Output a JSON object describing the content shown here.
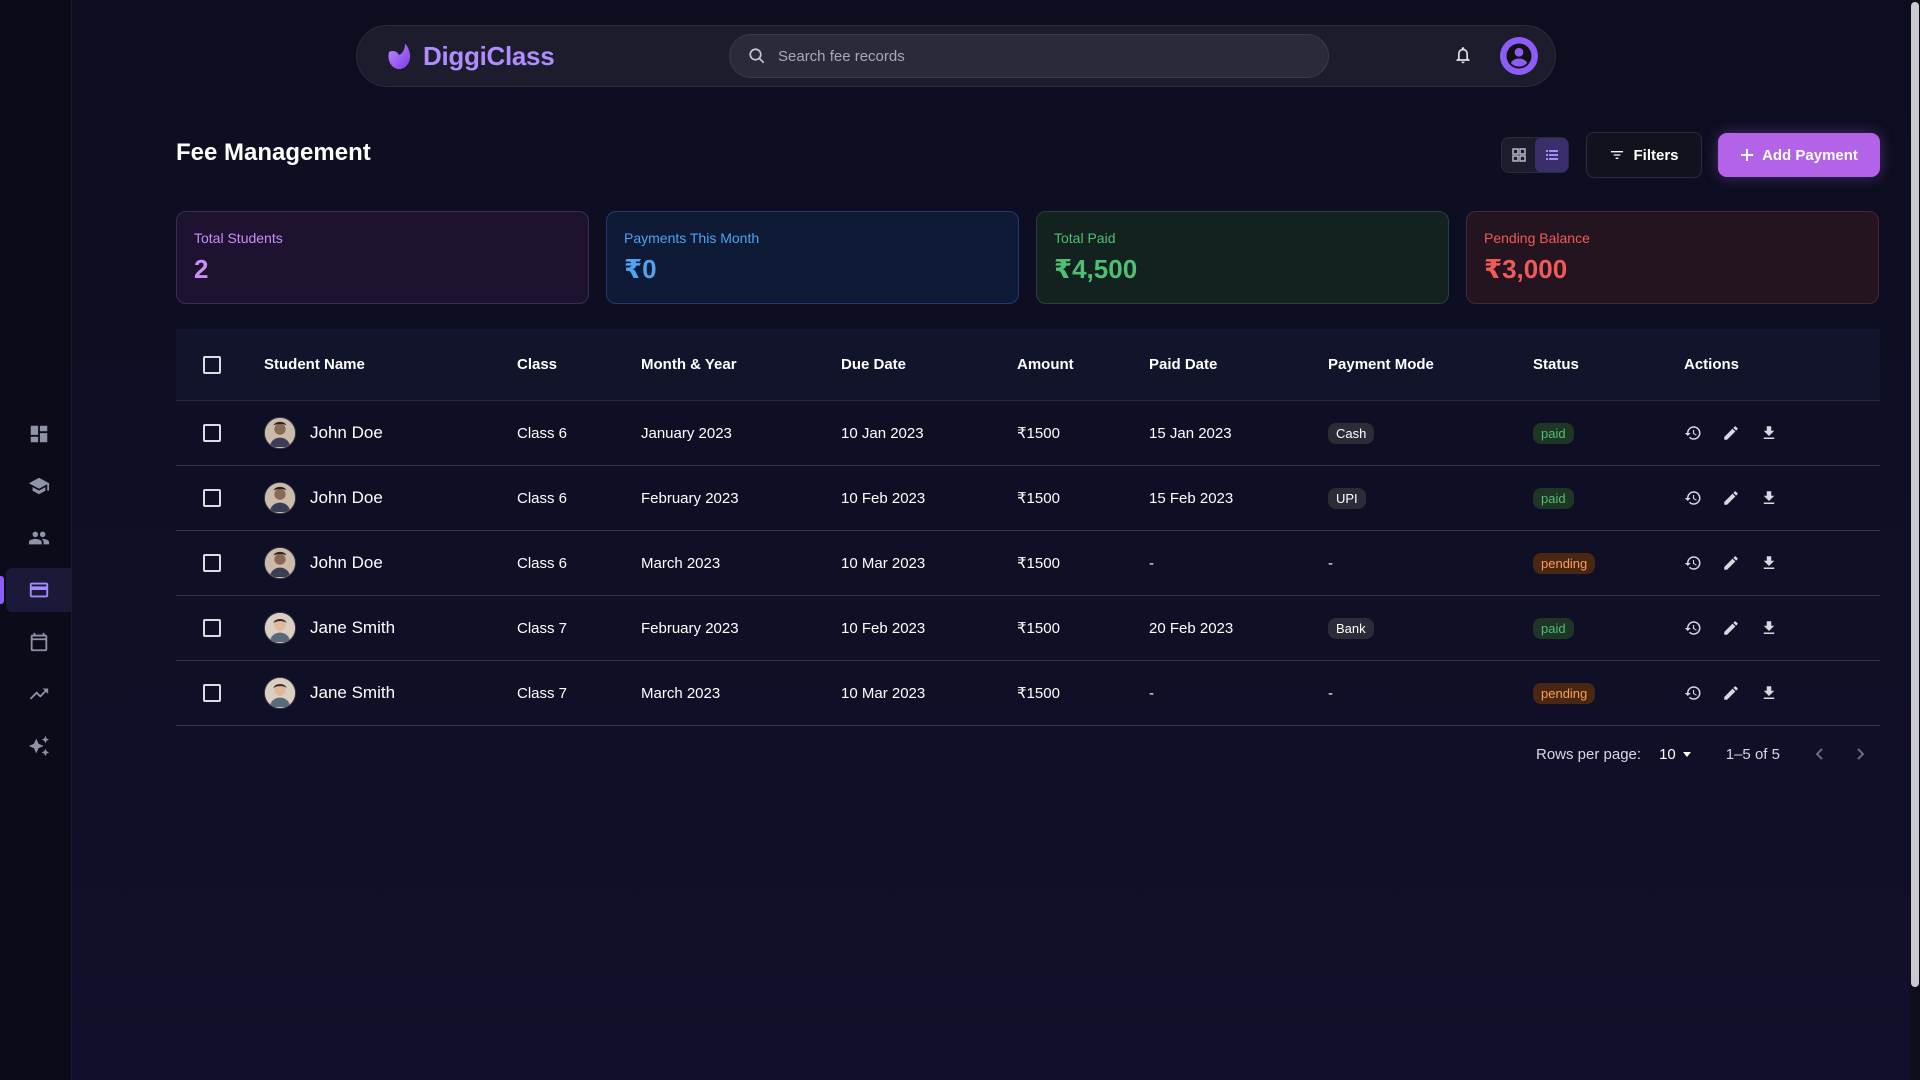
{
  "app": {
    "name": "DiggiClass"
  },
  "search": {
    "placeholder": "Search fee records"
  },
  "page": {
    "title": "Fee Management"
  },
  "toolbar": {
    "filters_label": "Filters",
    "add_label": "Add Payment"
  },
  "stats": [
    {
      "label": "Total Students",
      "value": "2"
    },
    {
      "label": "Payments This Month",
      "value": "₹0"
    },
    {
      "label": "Total Paid",
      "value": "₹4,500"
    },
    {
      "label": "Pending Balance",
      "value": "₹3,000"
    }
  ],
  "table": {
    "headers": [
      "Student Name",
      "Class",
      "Month & Year",
      "Due Date",
      "Amount",
      "Paid Date",
      "Payment Mode",
      "Status",
      "Actions"
    ],
    "rows": [
      {
        "name": "John Doe",
        "class": "Class 6",
        "month": "January 2023",
        "due": "10 Jan 2023",
        "amount": "₹1500",
        "paid": "15 Jan 2023",
        "mode": "Cash",
        "status": "paid"
      },
      {
        "name": "John Doe",
        "class": "Class 6",
        "month": "February 2023",
        "due": "10 Feb 2023",
        "amount": "₹1500",
        "paid": "15 Feb 2023",
        "mode": "UPI",
        "status": "paid"
      },
      {
        "name": "John Doe",
        "class": "Class 6",
        "month": "March 2023",
        "due": "10 Mar 2023",
        "amount": "₹1500",
        "paid": "-",
        "mode": "-",
        "status": "pending"
      },
      {
        "name": "Jane Smith",
        "class": "Class 7",
        "month": "February 2023",
        "due": "10 Feb 2023",
        "amount": "₹1500",
        "paid": "20 Feb 2023",
        "mode": "Bank",
        "status": "paid"
      },
      {
        "name": "Jane Smith",
        "class": "Class 7",
        "month": "March 2023",
        "due": "10 Mar 2023",
        "amount": "₹1500",
        "paid": "-",
        "mode": "-",
        "status": "pending"
      }
    ]
  },
  "pagination": {
    "rows_label": "Rows per page:",
    "rows_value": "10",
    "range": "1–5 of 5"
  },
  "sidebar": {
    "icons": [
      "dashboard-icon",
      "school-icon",
      "people-icon",
      "payment-card-icon",
      "calendar-icon",
      "trending-up-icon",
      "sparkle-icon"
    ],
    "active": "payment-card-icon"
  },
  "colors": {
    "accent": "#8b5cf6",
    "add_button": "#b263e8",
    "total_students": "#c98ff5",
    "payments_month": "#4ea3f2",
    "total_paid": "#4fbf73",
    "pending_balance": "#ef5a5a",
    "status_paid": "#4fbf73",
    "status_pending": "#f5a05a"
  }
}
